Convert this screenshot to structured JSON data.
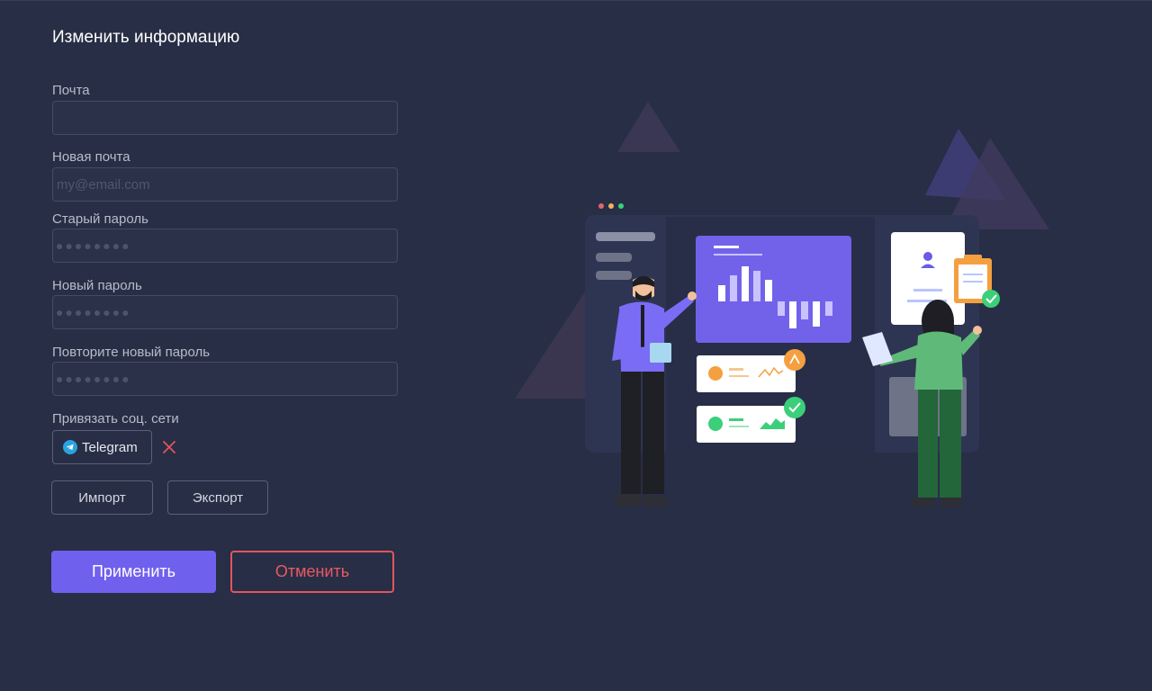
{
  "form": {
    "title": "Изменить информацию",
    "email": {
      "label": "Почта",
      "value": "",
      "placeholder": ""
    },
    "new_email": {
      "label": "Новая почта",
      "value": "",
      "placeholder": "my@email.com"
    },
    "old_password": {
      "label": "Старый пароль",
      "mask": "●●●●●●●●"
    },
    "new_password": {
      "label": "Новый пароль",
      "mask": "●●●●●●●●"
    },
    "repeat_password": {
      "label": "Повторите новый пароль",
      "mask": "●●●●●●●●"
    },
    "social": {
      "label": "Привязать соц. сети",
      "telegram_label": "Telegram",
      "telegram_icon": "telegram-icon",
      "remove_icon": "close-icon"
    },
    "import_label": "Импорт",
    "export_label": "Экспорт",
    "apply_label": "Применить",
    "cancel_label": "Отменить"
  },
  "colors": {
    "background": "#282e45",
    "accent": "#7060ee",
    "danger": "#e0555e",
    "telegram": "#2aa3e0",
    "input_border": "#454b63"
  },
  "illustration": {
    "name": "team-dashboard-illustration"
  }
}
